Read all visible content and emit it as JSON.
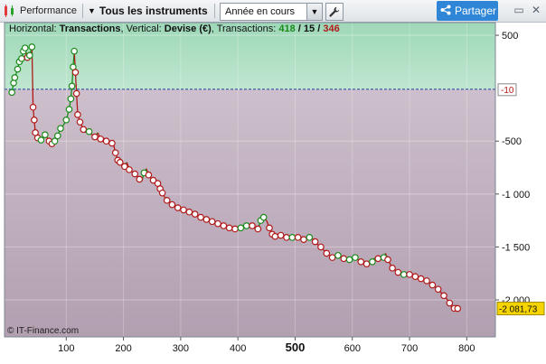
{
  "toolbar": {
    "performance_label": "Performance",
    "instrument_label": "Tous les instruments",
    "period_value": "Année en cours",
    "share_label": "Partager"
  },
  "info": {
    "prefix_h": "Horizontal: ",
    "h_value": "Transactions",
    "prefix_v": ", Vertical: ",
    "v_value": "Devise (€)",
    "prefix_t": ", Transactions: ",
    "t_win": "418",
    "t_sep1": " / ",
    "t_neutral": "15",
    "t_sep2": " / ",
    "t_loss": "346"
  },
  "copyright": "© IT-Finance.com",
  "colors": {
    "above_zero": "#a8dcc0",
    "below_zero": "#c7bcc8",
    "win": "#1a8a1a",
    "loss": "#b01a1a",
    "zero_line": "#3050a0",
    "current_flag": "#f5d400"
  },
  "chart_data": {
    "type": "line",
    "xlabel": "",
    "ylabel": "",
    "xlim": [
      0,
      850
    ],
    "ylim": [
      -2350,
      620
    ],
    "x_ticks": [
      "100",
      "200",
      "300",
      "400",
      "500",
      "600",
      "700",
      "800"
    ],
    "x_tick_values": [
      100,
      200,
      300,
      400,
      500,
      600,
      700,
      800
    ],
    "x_tick_bold": "500",
    "y_ticks": [
      "500",
      "-500",
      "-1 000",
      "-1 500",
      "-2 000"
    ],
    "y_tick_values": [
      500,
      -500,
      -1000,
      -1500,
      -2000
    ],
    "reference_label": "-10",
    "reference_value": -10,
    "current_label": "-2 081,73",
    "current_value": -2081.73,
    "points": [
      [
        5,
        -40
      ],
      [
        8,
        50
      ],
      [
        10,
        100
      ],
      [
        12,
        130
      ],
      [
        15,
        180
      ],
      [
        18,
        250
      ],
      [
        22,
        280
      ],
      [
        25,
        350
      ],
      [
        28,
        380
      ],
      [
        32,
        290
      ],
      [
        36,
        310
      ],
      [
        40,
        390
      ],
      [
        42,
        -180
      ],
      [
        44,
        -300
      ],
      [
        46,
        -420
      ],
      [
        48,
        -450
      ],
      [
        50,
        -470
      ],
      [
        52,
        -500
      ],
      [
        56,
        -490
      ],
      [
        60,
        -470
      ],
      [
        63,
        -440
      ],
      [
        66,
        -460
      ],
      [
        70,
        -500
      ],
      [
        72,
        -520
      ],
      [
        75,
        -525
      ],
      [
        78,
        -530
      ],
      [
        80,
        -500
      ],
      [
        85,
        -450
      ],
      [
        90,
        -380
      ],
      [
        95,
        -350
      ],
      [
        100,
        -300
      ],
      [
        105,
        -200
      ],
      [
        108,
        -100
      ],
      [
        110,
        20
      ],
      [
        112,
        200
      ],
      [
        114,
        350
      ],
      [
        116,
        150
      ],
      [
        118,
        -50
      ],
      [
        120,
        -250
      ],
      [
        124,
        -320
      ],
      [
        130,
        -390
      ],
      [
        135,
        -420
      ],
      [
        140,
        -410
      ],
      [
        145,
        -440
      ],
      [
        150,
        -460
      ],
      [
        155,
        -420
      ],
      [
        160,
        -480
      ],
      [
        165,
        -470
      ],
      [
        170,
        -500
      ],
      [
        175,
        -510
      ],
      [
        180,
        -520
      ],
      [
        183,
        -540
      ],
      [
        186,
        -610
      ],
      [
        190,
        -680
      ],
      [
        194,
        -700
      ],
      [
        198,
        -720
      ],
      [
        202,
        -740
      ],
      [
        206,
        -700
      ],
      [
        210,
        -770
      ],
      [
        215,
        -790
      ],
      [
        220,
        -810
      ],
      [
        224,
        -830
      ],
      [
        228,
        -860
      ],
      [
        232,
        -880
      ],
      [
        236,
        -800
      ],
      [
        240,
        -760
      ],
      [
        244,
        -820
      ],
      [
        248,
        -850
      ],
      [
        252,
        -870
      ],
      [
        256,
        -880
      ],
      [
        260,
        -900
      ],
      [
        264,
        -950
      ],
      [
        268,
        -990
      ],
      [
        272,
        -1030
      ],
      [
        276,
        -1060
      ],
      [
        280,
        -1080
      ],
      [
        285,
        -1100
      ],
      [
        290,
        -1120
      ],
      [
        295,
        -1130
      ],
      [
        300,
        -1140
      ],
      [
        305,
        -1150
      ],
      [
        310,
        -1160
      ],
      [
        315,
        -1170
      ],
      [
        320,
        -1180
      ],
      [
        325,
        -1190
      ],
      [
        330,
        -1200
      ],
      [
        335,
        -1220
      ],
      [
        340,
        -1230
      ],
      [
        345,
        -1240
      ],
      [
        350,
        -1250
      ],
      [
        355,
        -1260
      ],
      [
        360,
        -1270
      ],
      [
        365,
        -1280
      ],
      [
        370,
        -1290
      ],
      [
        375,
        -1300
      ],
      [
        380,
        -1310
      ],
      [
        385,
        -1320
      ],
      [
        390,
        -1325
      ],
      [
        395,
        -1330
      ],
      [
        400,
        -1330
      ],
      [
        405,
        -1320
      ],
      [
        410,
        -1310
      ],
      [
        415,
        -1300
      ],
      [
        420,
        -1290
      ],
      [
        425,
        -1300
      ],
      [
        430,
        -1310
      ],
      [
        435,
        -1330
      ],
      [
        440,
        -1250
      ],
      [
        445,
        -1220
      ],
      [
        450,
        -1250
      ],
      [
        455,
        -1320
      ],
      [
        460,
        -1380
      ],
      [
        465,
        -1400
      ],
      [
        470,
        -1380
      ],
      [
        475,
        -1390
      ],
      [
        480,
        -1400
      ],
      [
        485,
        -1410
      ],
      [
        490,
        -1420
      ],
      [
        495,
        -1410
      ],
      [
        500,
        -1400
      ],
      [
        505,
        -1410
      ],
      [
        510,
        -1420
      ],
      [
        515,
        -1430
      ],
      [
        520,
        -1420
      ],
      [
        525,
        -1410
      ],
      [
        530,
        -1420
      ],
      [
        535,
        -1450
      ],
      [
        540,
        -1480
      ],
      [
        545,
        -1500
      ],
      [
        550,
        -1530
      ],
      [
        555,
        -1560
      ],
      [
        560,
        -1580
      ],
      [
        565,
        -1600
      ],
      [
        570,
        -1590
      ],
      [
        575,
        -1580
      ],
      [
        580,
        -1590
      ],
      [
        585,
        -1610
      ],
      [
        590,
        -1620
      ],
      [
        595,
        -1620
      ],
      [
        600,
        -1610
      ],
      [
        605,
        -1600
      ],
      [
        610,
        -1620
      ],
      [
        615,
        -1640
      ],
      [
        620,
        -1650
      ],
      [
        625,
        -1660
      ],
      [
        630,
        -1650
      ],
      [
        635,
        -1640
      ],
      [
        640,
        -1600
      ],
      [
        645,
        -1610
      ],
      [
        650,
        -1620
      ],
      [
        655,
        -1600
      ],
      [
        658,
        -1560
      ],
      [
        662,
        -1620
      ],
      [
        666,
        -1660
      ],
      [
        670,
        -1700
      ],
      [
        675,
        -1720
      ],
      [
        680,
        -1740
      ],
      [
        685,
        -1760
      ],
      [
        690,
        -1760
      ],
      [
        695,
        -1750
      ],
      [
        700,
        -1760
      ],
      [
        705,
        -1770
      ],
      [
        710,
        -1780
      ],
      [
        715,
        -1790
      ],
      [
        720,
        -1800
      ],
      [
        725,
        -1810
      ],
      [
        730,
        -1820
      ],
      [
        735,
        -1840
      ],
      [
        740,
        -1860
      ],
      [
        745,
        -1880
      ],
      [
        750,
        -1900
      ],
      [
        755,
        -1930
      ],
      [
        760,
        -1960
      ],
      [
        765,
        -1990
      ],
      [
        770,
        -2030
      ],
      [
        774,
        -2070
      ],
      [
        778,
        -2080
      ],
      [
        782,
        -2050
      ],
      [
        784,
        -2081.73
      ]
    ]
  }
}
